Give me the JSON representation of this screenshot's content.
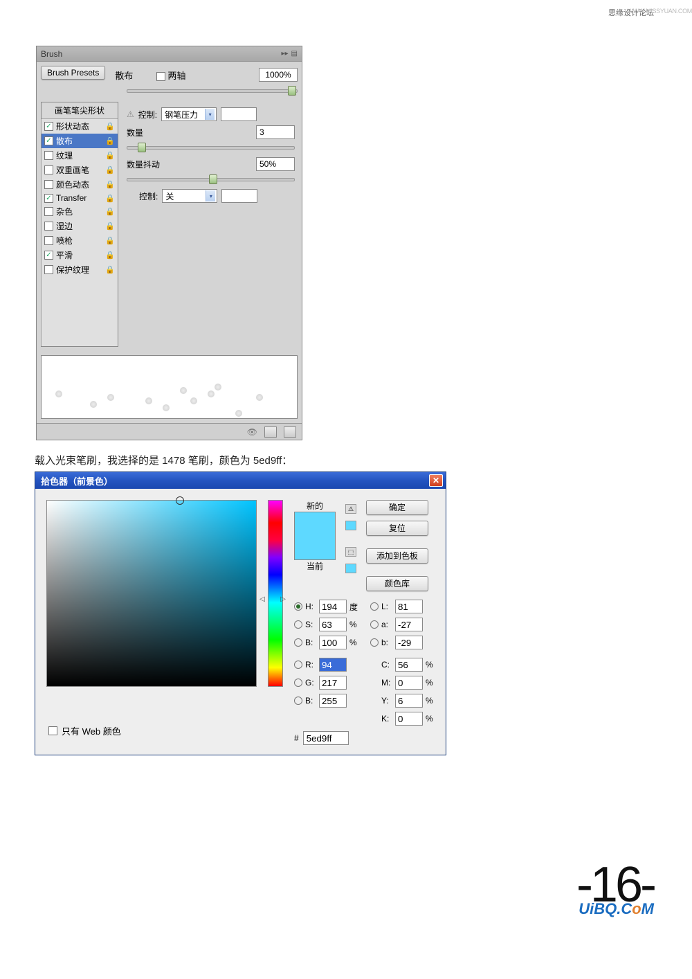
{
  "header": {
    "forum": "思缘设计论坛",
    "url": "WWW.MISSYUAN.COM"
  },
  "brush": {
    "title": "Brush",
    "presets_btn": "Brush Presets",
    "sidebar_header": "画笔笔尖形状",
    "sidebar": [
      {
        "label": "形状动态",
        "checked": true
      },
      {
        "label": "散布",
        "checked": true
      },
      {
        "label": "纹理",
        "checked": false
      },
      {
        "label": "双重画笔",
        "checked": false
      },
      {
        "label": "颜色动态",
        "checked": false
      },
      {
        "label": "Transfer",
        "checked": true
      },
      {
        "label": "杂色",
        "checked": false
      },
      {
        "label": "湿边",
        "checked": false
      },
      {
        "label": "喷枪",
        "checked": false
      },
      {
        "label": "平滑",
        "checked": true
      },
      {
        "label": "保护纹理",
        "checked": false
      }
    ],
    "scatter_label": "散布",
    "both_axes": "两轴",
    "scatter_value": "1000%",
    "control1_label": "控制:",
    "control1_value": "钢笔压力",
    "count_label": "数量",
    "count_value": "3",
    "jitter_label": "数量抖动",
    "jitter_value": "50%",
    "control2_label": "控制:",
    "control2_value": "关"
  },
  "caption": "载入光束笔刷，我选择的是 1478 笔刷，颜色为 5ed9ff：",
  "picker": {
    "title": "拾色器（前景色）",
    "new_label": "新的",
    "current_label": "当前",
    "ok": "确定",
    "cancel": "复位",
    "add_swatch": "添加到色板",
    "color_lib": "颜色库",
    "H": "194",
    "H_unit": "度",
    "S": "63",
    "B": "100",
    "L": "81",
    "a": "-27",
    "b": "-29",
    "R": "94",
    "G": "217",
    "Bv": "255",
    "C": "56",
    "M": "0",
    "Y": "6",
    "K": "0",
    "hex": "5ed9ff",
    "web_only": "只有 Web 颜色"
  },
  "footer": {
    "page": "-16-",
    "brand": "UiBQ.CoM"
  }
}
